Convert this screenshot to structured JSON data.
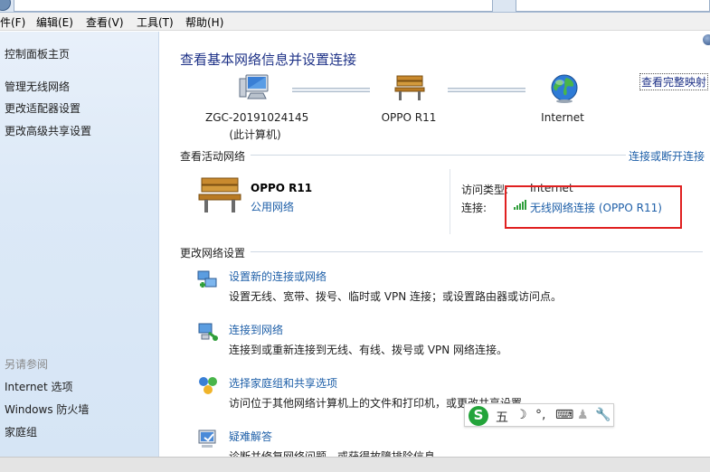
{
  "menu": {
    "file": "件(F)",
    "edit": "编辑(E)",
    "view": "查看(V)",
    "tools": "工具(T)",
    "help": "帮助(H)"
  },
  "sidebar": {
    "items": [
      "控制面板主页",
      "管理无线网络",
      "更改适配器设置",
      "更改高级共享设置"
    ],
    "see_also_header": "另请参阅",
    "see_also": [
      "Internet 选项",
      "Windows 防火墙",
      "家庭组"
    ]
  },
  "main": {
    "title": "查看基本网络信息并设置连接",
    "full_map_link": "查看完整映射",
    "nodes": [
      {
        "label": "ZGC-20191024145",
        "sublabel": "(此计算机)",
        "icon": "computer-icon"
      },
      {
        "label": "OPPO R11",
        "icon": "bench-network-icon"
      },
      {
        "label": "Internet",
        "icon": "globe-icon"
      }
    ],
    "active_section_title": "查看活动网络",
    "connect_disconnect_link": "连接或断开连接",
    "network": {
      "name": "OPPO R11",
      "type": "公用网络",
      "access_type_label": "访问类型:",
      "access_type_value": "Internet",
      "connection_label": "连接:",
      "connection_value": "无线网络连接 (OPPO R11)"
    },
    "change_section_title": "更改网络设置",
    "tasks": [
      {
        "title": "设置新的连接或网络",
        "desc": "设置无线、宽带、拨号、临时或 VPN 连接；或设置路由器或访问点。",
        "icon": "new-connection-icon"
      },
      {
        "title": "连接到网络",
        "desc": "连接到或重新连接到无线、有线、拨号或 VPN 网络连接。",
        "icon": "connect-network-icon"
      },
      {
        "title": "选择家庭组和共享选项",
        "desc": "访问位于其他网络计算机上的文件和打印机，或更改共享设置。",
        "icon": "homegroup-icon"
      },
      {
        "title": "疑难解答",
        "desc": "诊断并修复网络问题，或获得故障排除信息。",
        "icon": "troubleshoot-icon"
      }
    ]
  },
  "ime": {
    "logo": "S",
    "mode": "五",
    "glyphs": [
      "☽",
      "°,",
      "⌨",
      "♟",
      "🔧"
    ]
  },
  "colors": {
    "link": "#1e5fa8",
    "title": "#1e3287",
    "highlight": "#e02020",
    "sidebar_bg": "#dce9f7"
  }
}
